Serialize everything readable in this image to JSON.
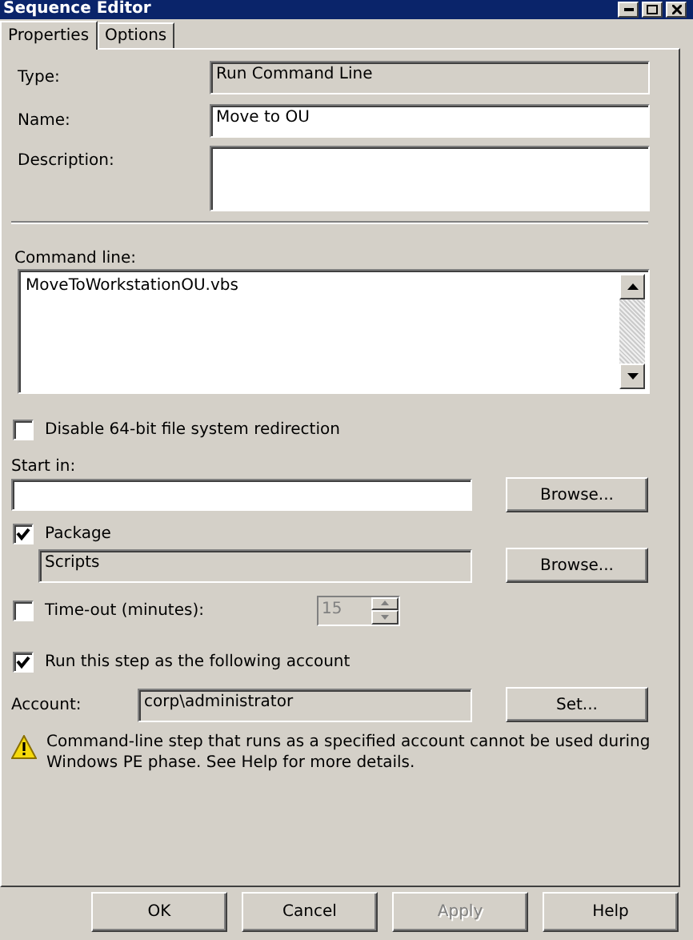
{
  "window": {
    "title": "Sequence Editor"
  },
  "tabs": [
    {
      "label": "Properties",
      "selected": true
    },
    {
      "label": "Options",
      "selected": false
    }
  ],
  "type": {
    "label": "Type:",
    "value": "Run Command Line"
  },
  "name": {
    "label": "Name:",
    "value": "Move to OU"
  },
  "description": {
    "label": "Description:"
  },
  "command_line": {
    "label": "Command line:",
    "value": "MoveToWorkstationOU.vbs"
  },
  "disable_redirection": {
    "label": "Disable 64-bit file system redirection",
    "checked": false
  },
  "start_in": {
    "label": "Start in:",
    "button": "Browse..."
  },
  "package": {
    "label": "Package",
    "checked": true,
    "value": "Scripts",
    "button": "Browse..."
  },
  "timeout": {
    "label": "Time-out (minutes):",
    "checked": false,
    "value": "15"
  },
  "run_as": {
    "label": "Run this step as the following account",
    "checked": true
  },
  "account": {
    "label": "Account:",
    "value": "corp\\administrator",
    "button": "Set..."
  },
  "warning": "Command-line step that runs as a specified account cannot be used during Windows PE phase. See Help for more details.",
  "buttons": [
    {
      "label": "OK",
      "disabled": false
    },
    {
      "label": "Cancel",
      "disabled": false
    },
    {
      "label": "Apply",
      "disabled": true
    },
    {
      "label": "Help",
      "disabled": false
    }
  ]
}
